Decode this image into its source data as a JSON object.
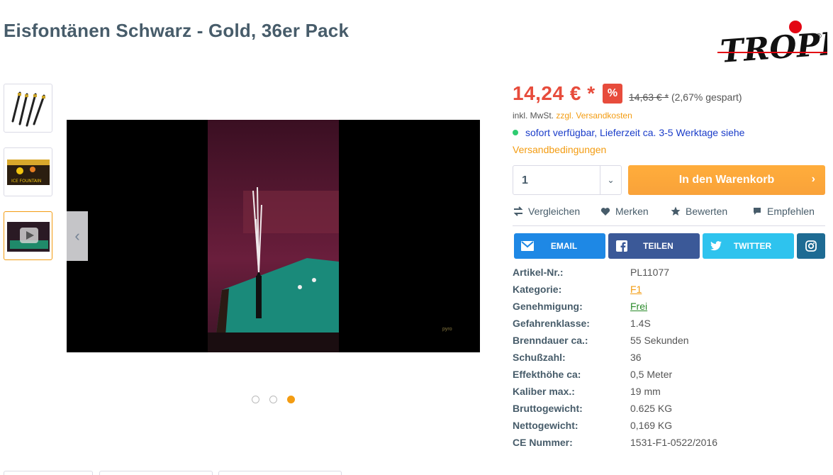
{
  "product": {
    "title": "Eisfontänen Schwarz - Gold, 36er Pack"
  },
  "brand": {
    "logo_text": "TROPIC",
    "registered": "®"
  },
  "gallery": {
    "thumbnails": [
      {
        "name": "sparklers"
      },
      {
        "name": "box",
        "text": "ICE FOUNTAIN"
      },
      {
        "name": "video"
      }
    ],
    "video_watermark": "pyro",
    "active_dot": 3,
    "dot_count": 3
  },
  "pricing": {
    "price": "14,24 € *",
    "discount_badge": "%",
    "old_price": "14,63 € *",
    "saved": "(2,67% gespart)",
    "tax_prefix": "inkl. MwSt.",
    "shipping_link": "zzgl. Versandkosten"
  },
  "availability": {
    "status": "sofort verfügbar, Lieferzeit ca. 3-5 Werktage siehe",
    "link": "Versandbedingungen",
    "status_color": "#2ecc71"
  },
  "cart": {
    "quantity": "1",
    "button": "In den Warenkorb",
    "button_color": "#f9a23a"
  },
  "actions": [
    {
      "label": "Vergleichen",
      "icon": "compare-icon"
    },
    {
      "label": "Merken",
      "icon": "heart-icon"
    },
    {
      "label": "Bewerten",
      "icon": "star-icon"
    },
    {
      "label": "Empfehlen",
      "icon": "comment-icon"
    }
  ],
  "share": [
    {
      "label": "EMAIL",
      "icon": "email-icon",
      "color": "#1e88e5"
    },
    {
      "label": "TEILEN",
      "icon": "facebook-icon",
      "color": "#3b5998"
    },
    {
      "label": "TWITTER",
      "icon": "twitter-icon",
      "color": "#2ec3ee"
    },
    {
      "label": "",
      "icon": "instagram-icon",
      "color": "#1e6b93"
    }
  ],
  "specs": [
    {
      "key": "Artikel-Nr.:",
      "value": "PL11077"
    },
    {
      "key": "Kategorie:",
      "value": "F1",
      "style": "orange"
    },
    {
      "key": "Genehmigung:",
      "value": "Frei",
      "style": "green"
    },
    {
      "key": "Gefahrenklasse:",
      "value": "1.4S"
    },
    {
      "key": "Brenndauer ca.:",
      "value": "55 Sekunden"
    },
    {
      "key": "Schußzahl:",
      "value": "36"
    },
    {
      "key": "Effekthöhe ca:",
      "value": "0,5 Meter"
    },
    {
      "key": "Kaliber max.:",
      "value": "19 mm"
    },
    {
      "key": "Bruttogewicht:",
      "value": "0.625 KG"
    },
    {
      "key": "Nettogewicht:",
      "value": "0,169 KG"
    },
    {
      "key": "CE Nummer:",
      "value": "1531-F1-0522/2016"
    }
  ]
}
